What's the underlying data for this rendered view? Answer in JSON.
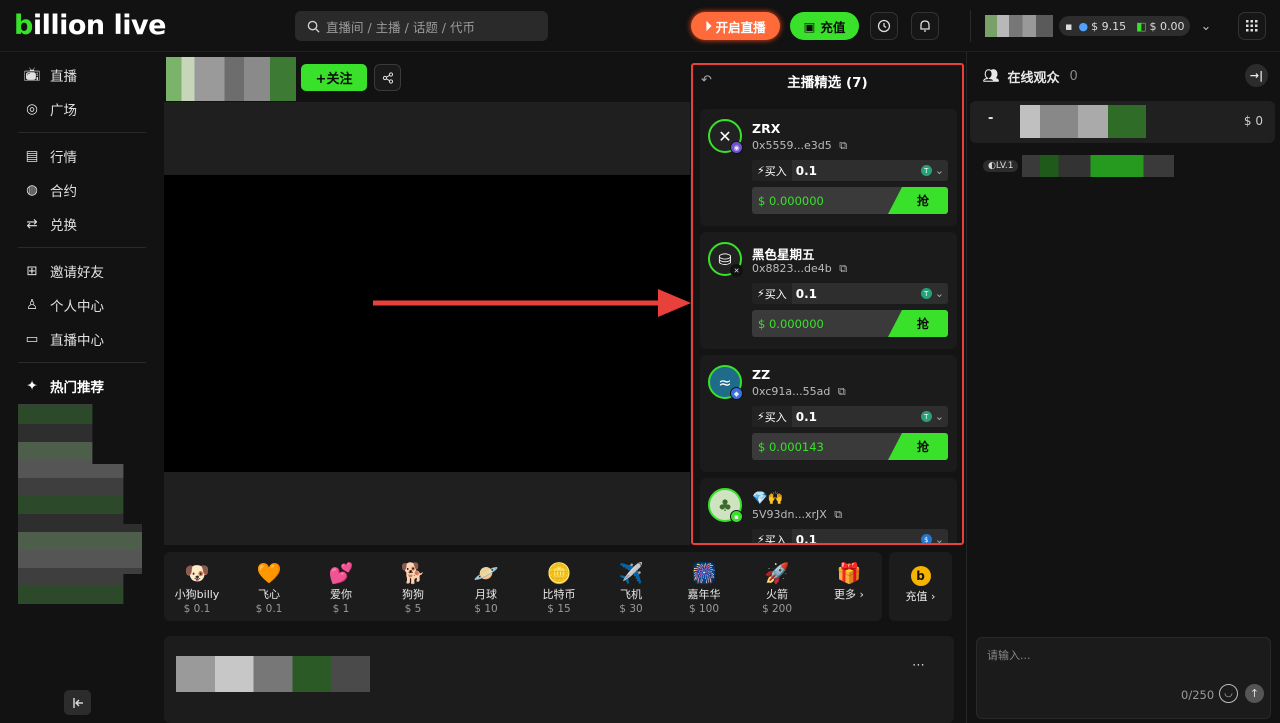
{
  "header": {
    "logo_main": "billion live",
    "search_placeholder": "直播间 / 主播 / 话题 / 代币",
    "start_live": "开启直播",
    "deposit": "充值",
    "balance_a": "$ 9.15",
    "balance_b": "$ 0.00"
  },
  "sidebar": {
    "items": [
      "直播",
      "广场",
      "行情",
      "合约",
      "兑换",
      "邀请好友",
      "个人中心",
      "直播中心"
    ],
    "hot_title": "热门推荐"
  },
  "stream": {
    "follow": "+关注"
  },
  "panel": {
    "title": "主播精选 (7)",
    "cards": [
      {
        "name": "ZRX",
        "addr": "0x5559...e3d5",
        "buy_label": "买入",
        "buy_value": "0.1",
        "price": "0.000000",
        "grab": "抢",
        "icon": "zrx-icon"
      },
      {
        "name": "黑色星期五",
        "addr": "0x8823...de4b",
        "buy_label": "买入",
        "buy_value": "0.1",
        "price": "0.000000",
        "grab": "抢",
        "icon": "coin-stack-icon"
      },
      {
        "name": "ZZ",
        "addr": "0xc91a...55ad",
        "buy_label": "买入",
        "buy_value": "0.1",
        "price": "0.000143",
        "grab": "抢",
        "icon": "zz-icon"
      },
      {
        "name": "💎🙌",
        "addr": "5V93dn...xrJX",
        "buy_label": "买入",
        "buy_value": "0.1",
        "price": "",
        "grab": "",
        "icon": "tree-icon"
      }
    ]
  },
  "gifts": [
    {
      "icon": "🐶",
      "name": "小狗billy",
      "price": "$ 0.1"
    },
    {
      "icon": "🧡",
      "name": "飞心",
      "price": "$ 0.1"
    },
    {
      "icon": "💕",
      "name": "爱你",
      "price": "$ 1"
    },
    {
      "icon": "🐕",
      "name": "狗狗",
      "price": "$ 5"
    },
    {
      "icon": "🪐",
      "name": "月球",
      "price": "$ 10"
    },
    {
      "icon": "🪙",
      "name": "比特币",
      "price": "$ 15"
    },
    {
      "icon": "✈️",
      "name": "飞机",
      "price": "$ 30"
    },
    {
      "icon": "🎆",
      "name": "嘉年华",
      "price": "$ 100"
    },
    {
      "icon": "🚀",
      "name": "火箭",
      "price": "$ 200"
    }
  ],
  "gifts_more": "更多 ›",
  "recharge": "充值 ›",
  "right": {
    "online_title": "在线观众",
    "online_count": "0",
    "viewer_dash": "-",
    "viewer_amount": "$ 0",
    "level": "LV.1",
    "input_placeholder": "请输入...",
    "char_count": "0/250"
  },
  "colors": {
    "accent": "#39e12a",
    "live": "#ff6a3a",
    "highlight": "#e8403a"
  }
}
